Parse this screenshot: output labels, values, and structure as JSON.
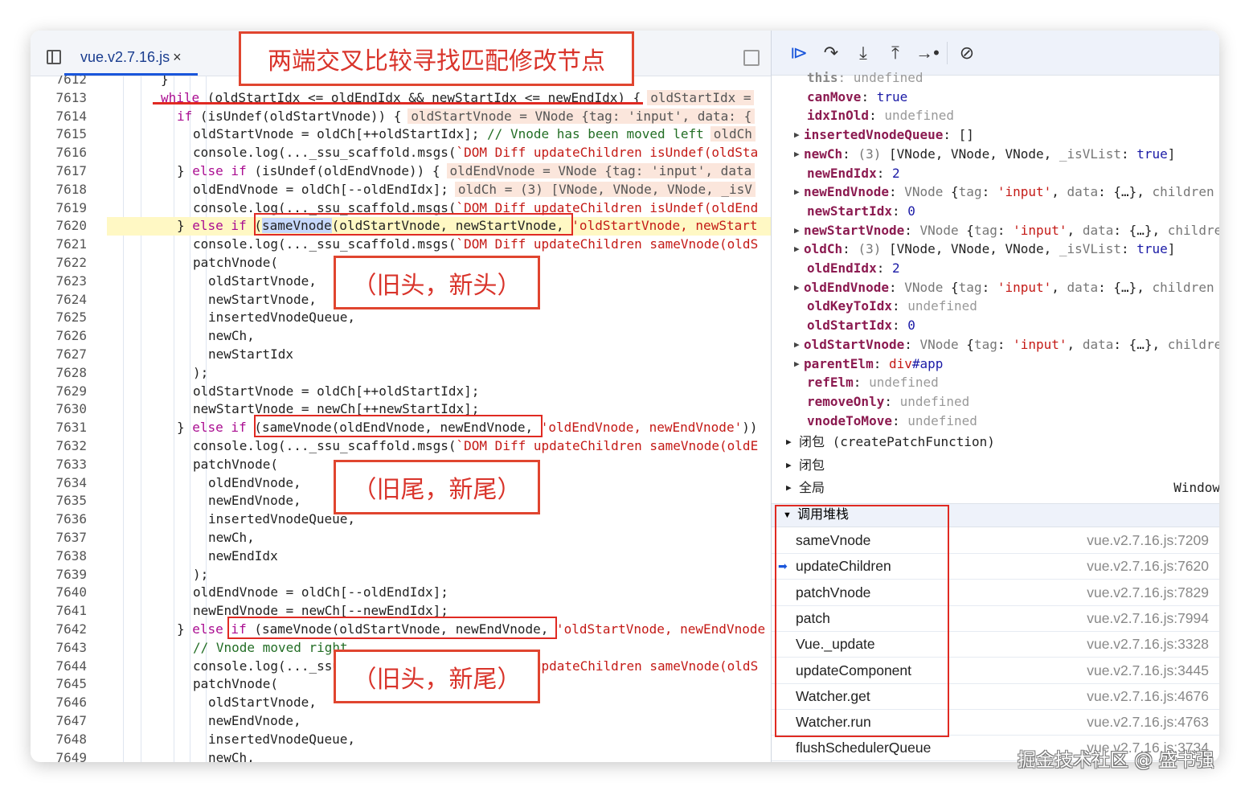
{
  "editor": {
    "tab_label": "vue.v2.7.16.js",
    "tab_close": "×",
    "lines": [
      {
        "n": "7612",
        "i": 0,
        "t": [
          [
            "p",
            "}"
          ]
        ]
      },
      {
        "n": "7613",
        "i": 0,
        "t": [
          [
            "k",
            "while"
          ],
          [
            "p",
            " (oldStartIdx <= oldEndIdx && newStartIdx <= newEndIdx) {"
          ],
          [
            "v",
            "oldStartIdx ="
          ]
        ]
      },
      {
        "n": "7614",
        "i": 1,
        "t": [
          [
            "k",
            "if"
          ],
          [
            "p",
            " (isUndef(oldStartVnode)) {"
          ],
          [
            "v",
            "oldStartVnode = VNode {tag: 'input', data: {"
          ]
        ]
      },
      {
        "n": "7615",
        "i": 2,
        "t": [
          [
            "p",
            "oldStartVnode = oldCh[++oldStartIdx]; "
          ],
          [
            "c",
            "// Vnode has been moved left"
          ],
          [
            "v",
            "oldCh"
          ]
        ]
      },
      {
        "n": "7616",
        "i": 2,
        "t": [
          [
            "p",
            "console.log(..._ssu_scaffold.msgs("
          ],
          [
            "s",
            "`DOM Diff updateChildren isUndef(oldSta"
          ]
        ]
      },
      {
        "n": "7617",
        "i": 1,
        "t": [
          [
            "p",
            "} "
          ],
          [
            "k",
            "else if"
          ],
          [
            "p",
            " (isUndef(oldEndVnode)) {"
          ],
          [
            "v",
            "oldEndVnode = VNode {tag: 'input', data"
          ]
        ]
      },
      {
        "n": "7618",
        "i": 2,
        "t": [
          [
            "p",
            "oldEndVnode = oldCh[--oldEndIdx];"
          ],
          [
            "v",
            "oldCh = (3) [VNode, VNode, VNode, _isV"
          ]
        ]
      },
      {
        "n": "7619",
        "i": 2,
        "t": [
          [
            "p",
            "console.log(..._ssu_scaffold.msgs("
          ],
          [
            "s",
            "`DOM Diff updateChildren isUndef(oldEnd"
          ]
        ]
      },
      {
        "n": "7620",
        "i": 1,
        "hl": true,
        "t": [
          [
            "p",
            "} "
          ],
          [
            "k",
            "else if"
          ],
          [
            "p",
            " ("
          ],
          [
            "sel",
            "sameVnode"
          ],
          [
            "p",
            "(oldStartVnode, newStartVnode, "
          ],
          [
            "s",
            "'oldStartVnode, newStart"
          ]
        ]
      },
      {
        "n": "7621",
        "i": 2,
        "t": [
          [
            "p",
            "console.log(..._ssu_scaffold.msgs("
          ],
          [
            "s",
            "`DOM Diff updateChildren sameVnode(oldS"
          ]
        ]
      },
      {
        "n": "7622",
        "i": 2,
        "t": [
          [
            "p",
            "patchVnode("
          ]
        ]
      },
      {
        "n": "7623",
        "i": 3,
        "t": [
          [
            "p",
            "oldStartVnode,"
          ]
        ]
      },
      {
        "n": "7624",
        "i": 3,
        "t": [
          [
            "p",
            "newStartVnode,"
          ]
        ]
      },
      {
        "n": "7625",
        "i": 3,
        "t": [
          [
            "p",
            "insertedVnodeQueue,"
          ]
        ]
      },
      {
        "n": "7626",
        "i": 3,
        "t": [
          [
            "p",
            "newCh,"
          ]
        ]
      },
      {
        "n": "7627",
        "i": 3,
        "t": [
          [
            "p",
            "newStartIdx"
          ]
        ]
      },
      {
        "n": "7628",
        "i": 2,
        "t": [
          [
            "p",
            ");"
          ]
        ]
      },
      {
        "n": "7629",
        "i": 2,
        "t": [
          [
            "p",
            "oldStartVnode = oldCh[++oldStartIdx];"
          ]
        ]
      },
      {
        "n": "7630",
        "i": 2,
        "t": [
          [
            "p",
            "newStartVnode = newCh[++newStartIdx];"
          ]
        ]
      },
      {
        "n": "7631",
        "i": 1,
        "t": [
          [
            "p",
            "} "
          ],
          [
            "k",
            "else if"
          ],
          [
            "p",
            " (sameVnode(oldEndVnode, newEndVnode, "
          ],
          [
            "s",
            "'oldEndVnode, newEndVnode'"
          ],
          [
            "p",
            "))"
          ]
        ]
      },
      {
        "n": "7632",
        "i": 2,
        "t": [
          [
            "p",
            "console.log(..._ssu_scaffold.msgs("
          ],
          [
            "s",
            "`DOM Diff updateChildren sameVnode(oldE"
          ]
        ]
      },
      {
        "n": "7633",
        "i": 2,
        "t": [
          [
            "p",
            "patchVnode("
          ]
        ]
      },
      {
        "n": "7634",
        "i": 3,
        "t": [
          [
            "p",
            "oldEndVnode,"
          ]
        ]
      },
      {
        "n": "7635",
        "i": 3,
        "t": [
          [
            "p",
            "newEndVnode,"
          ]
        ]
      },
      {
        "n": "7636",
        "i": 3,
        "t": [
          [
            "p",
            "insertedVnodeQueue,"
          ]
        ]
      },
      {
        "n": "7637",
        "i": 3,
        "t": [
          [
            "p",
            "newCh,"
          ]
        ]
      },
      {
        "n": "7638",
        "i": 3,
        "t": [
          [
            "p",
            "newEndIdx"
          ]
        ]
      },
      {
        "n": "7639",
        "i": 2,
        "t": [
          [
            "p",
            ");"
          ]
        ]
      },
      {
        "n": "7640",
        "i": 2,
        "t": [
          [
            "p",
            "oldEndVnode = oldCh[--oldEndIdx];"
          ]
        ]
      },
      {
        "n": "7641",
        "i": 2,
        "t": [
          [
            "p",
            "newEndVnode = newCh[--newEndIdx];"
          ]
        ]
      },
      {
        "n": "7642",
        "i": 1,
        "t": [
          [
            "p",
            "} "
          ],
          [
            "k",
            "else if"
          ],
          [
            "p",
            " (sameVnode(oldStartVnode, newEndVnode, "
          ],
          [
            "s",
            "'oldStartVnode, newEndVnode"
          ]
        ]
      },
      {
        "n": "7643",
        "i": 2,
        "t": [
          [
            "c",
            "// Vnode moved right"
          ]
        ]
      },
      {
        "n": "7644",
        "i": 2,
        "t": [
          [
            "p",
            "console.log(..._ssu_scaffold.msgs("
          ],
          [
            "s",
            "`DOM Diff updateChildren sameVnode(oldS"
          ]
        ]
      },
      {
        "n": "7645",
        "i": 2,
        "t": [
          [
            "p",
            "patchVnode("
          ]
        ]
      },
      {
        "n": "7646",
        "i": 3,
        "t": [
          [
            "p",
            "oldStartVnode,"
          ]
        ]
      },
      {
        "n": "7647",
        "i": 3,
        "t": [
          [
            "p",
            "newEndVnode,"
          ]
        ]
      },
      {
        "n": "7648",
        "i": 3,
        "t": [
          [
            "p",
            "insertedVnodeQueue,"
          ]
        ]
      },
      {
        "n": "7649",
        "i": 3,
        "t": [
          [
            "p",
            "newCh,"
          ]
        ]
      }
    ]
  },
  "debugger_toolbar": {
    "buttons": [
      {
        "name": "resume-button",
        "icon": "resume-icon",
        "glyph": "⧐"
      },
      {
        "name": "step-over-button",
        "icon": "step-over-icon",
        "glyph": "↷"
      },
      {
        "name": "step-into-button",
        "icon": "step-into-icon",
        "glyph": "⤓"
      },
      {
        "name": "step-out-button",
        "icon": "step-out-icon",
        "glyph": "⤒"
      },
      {
        "name": "step-button",
        "icon": "step-icon",
        "glyph": "→•"
      },
      {
        "name": "deactivate-breakpoints-button",
        "icon": "breakpoints-off-icon",
        "glyph": "⊘"
      }
    ]
  },
  "scope": {
    "items": [
      {
        "key": "this",
        "exp": false,
        "dim": true,
        "v": [
          [
            "u",
            "undefined"
          ]
        ]
      },
      {
        "key": "canMove",
        "exp": false,
        "v": [
          [
            "b",
            "true"
          ]
        ]
      },
      {
        "key": "idxInOld",
        "exp": false,
        "v": [
          [
            "u",
            "undefined"
          ]
        ]
      },
      {
        "key": "insertedVnodeQueue",
        "exp": true,
        "v": [
          [
            "d",
            "[]"
          ]
        ]
      },
      {
        "key": "newCh",
        "exp": true,
        "v": [
          [
            "g",
            "(3) "
          ],
          [
            "d",
            "[VNode, VNode, VNode, "
          ],
          [
            "g",
            "_isVList"
          ],
          [
            "d",
            ": "
          ],
          [
            "b",
            "true"
          ],
          [
            "d",
            "]"
          ]
        ]
      },
      {
        "key": "newEndIdx",
        "exp": false,
        "v": [
          [
            "b",
            "2"
          ]
        ]
      },
      {
        "key": "newEndVnode",
        "exp": true,
        "v": [
          [
            "g",
            "VNode "
          ],
          [
            "d",
            "{"
          ],
          [
            "g",
            "tag"
          ],
          [
            "d",
            ": "
          ],
          [
            "r",
            "'input'"
          ],
          [
            "d",
            ", "
          ],
          [
            "g",
            "data"
          ],
          [
            "d",
            ": {…}, "
          ],
          [
            "g",
            "children"
          ]
        ]
      },
      {
        "key": "newStartIdx",
        "exp": false,
        "v": [
          [
            "b",
            "0"
          ]
        ]
      },
      {
        "key": "newStartVnode",
        "exp": true,
        "v": [
          [
            "g",
            "VNode "
          ],
          [
            "d",
            "{"
          ],
          [
            "g",
            "tag"
          ],
          [
            "d",
            ": "
          ],
          [
            "r",
            "'input'"
          ],
          [
            "d",
            ", "
          ],
          [
            "g",
            "data"
          ],
          [
            "d",
            ": {…}, "
          ],
          [
            "g",
            "children"
          ]
        ]
      },
      {
        "key": "oldCh",
        "exp": true,
        "v": [
          [
            "g",
            "(3) "
          ],
          [
            "d",
            "[VNode, VNode, VNode, "
          ],
          [
            "g",
            "_isVList"
          ],
          [
            "d",
            ": "
          ],
          [
            "b",
            "true"
          ],
          [
            "d",
            "]"
          ]
        ]
      },
      {
        "key": "oldEndIdx",
        "exp": false,
        "v": [
          [
            "b",
            "2"
          ]
        ]
      },
      {
        "key": "oldEndVnode",
        "exp": true,
        "v": [
          [
            "g",
            "VNode "
          ],
          [
            "d",
            "{"
          ],
          [
            "g",
            "tag"
          ],
          [
            "d",
            ": "
          ],
          [
            "r",
            "'input'"
          ],
          [
            "d",
            ", "
          ],
          [
            "g",
            "data"
          ],
          [
            "d",
            ": {…}, "
          ],
          [
            "g",
            "children"
          ]
        ]
      },
      {
        "key": "oldKeyToIdx",
        "exp": false,
        "v": [
          [
            "u",
            "undefined"
          ]
        ]
      },
      {
        "key": "oldStartIdx",
        "exp": false,
        "v": [
          [
            "b",
            "0"
          ]
        ]
      },
      {
        "key": "oldStartVnode",
        "exp": true,
        "v": [
          [
            "g",
            "VNode "
          ],
          [
            "d",
            "{"
          ],
          [
            "g",
            "tag"
          ],
          [
            "d",
            ": "
          ],
          [
            "r",
            "'input'"
          ],
          [
            "d",
            ", "
          ],
          [
            "g",
            "data"
          ],
          [
            "d",
            ": {…}, "
          ],
          [
            "g",
            "children"
          ]
        ]
      },
      {
        "key": "parentElm",
        "exp": true,
        "v": [
          [
            "r",
            "div"
          ],
          [
            "b",
            "#app"
          ]
        ]
      },
      {
        "key": "refElm",
        "exp": false,
        "v": [
          [
            "u",
            "undefined"
          ]
        ]
      },
      {
        "key": "removeOnly",
        "exp": false,
        "v": [
          [
            "u",
            "undefined"
          ]
        ]
      },
      {
        "key": "vnodeToMove",
        "exp": false,
        "v": [
          [
            "u",
            "undefined"
          ]
        ]
      }
    ],
    "sections": [
      {
        "label": "闭包",
        "suffix": " (createPatchFunction)",
        "right": ""
      },
      {
        "label": "闭包",
        "suffix": "",
        "right": ""
      },
      {
        "label": "全局",
        "suffix": "",
        "right": "Window"
      }
    ]
  },
  "call_stack": {
    "title": "调用堆栈",
    "frames": [
      {
        "fn": "sameVnode",
        "loc": "vue.v2.7.16.js:7209",
        "current": false
      },
      {
        "fn": "updateChildren",
        "loc": "vue.v2.7.16.js:7620",
        "current": true
      },
      {
        "fn": "patchVnode",
        "loc": "vue.v2.7.16.js:7829",
        "current": false
      },
      {
        "fn": "patch",
        "loc": "vue.v2.7.16.js:7994",
        "current": false
      },
      {
        "fn": "Vue._update",
        "loc": "vue.v2.7.16.js:3328",
        "current": false
      },
      {
        "fn": "updateComponent",
        "loc": "vue.v2.7.16.js:3445",
        "current": false
      },
      {
        "fn": "Watcher.get",
        "loc": "vue.v2.7.16.js:4676",
        "current": false
      },
      {
        "fn": "Watcher.run",
        "loc": "vue.v2.7.16.js:4763",
        "current": false
      },
      {
        "fn": "flushSchedulerQueue",
        "loc": "vue.v2.7.16.js:3734",
        "current": false
      }
    ]
  },
  "annotations": {
    "title": "两端交叉比较寻找匹配修改节点",
    "head_head": "（旧头，新头）",
    "tail_tail": "（旧尾，新尾）",
    "head_tail": "（旧头，新尾）",
    "color": "#e0452f"
  },
  "watermark": "掘金技术社区 @ 盛书强"
}
